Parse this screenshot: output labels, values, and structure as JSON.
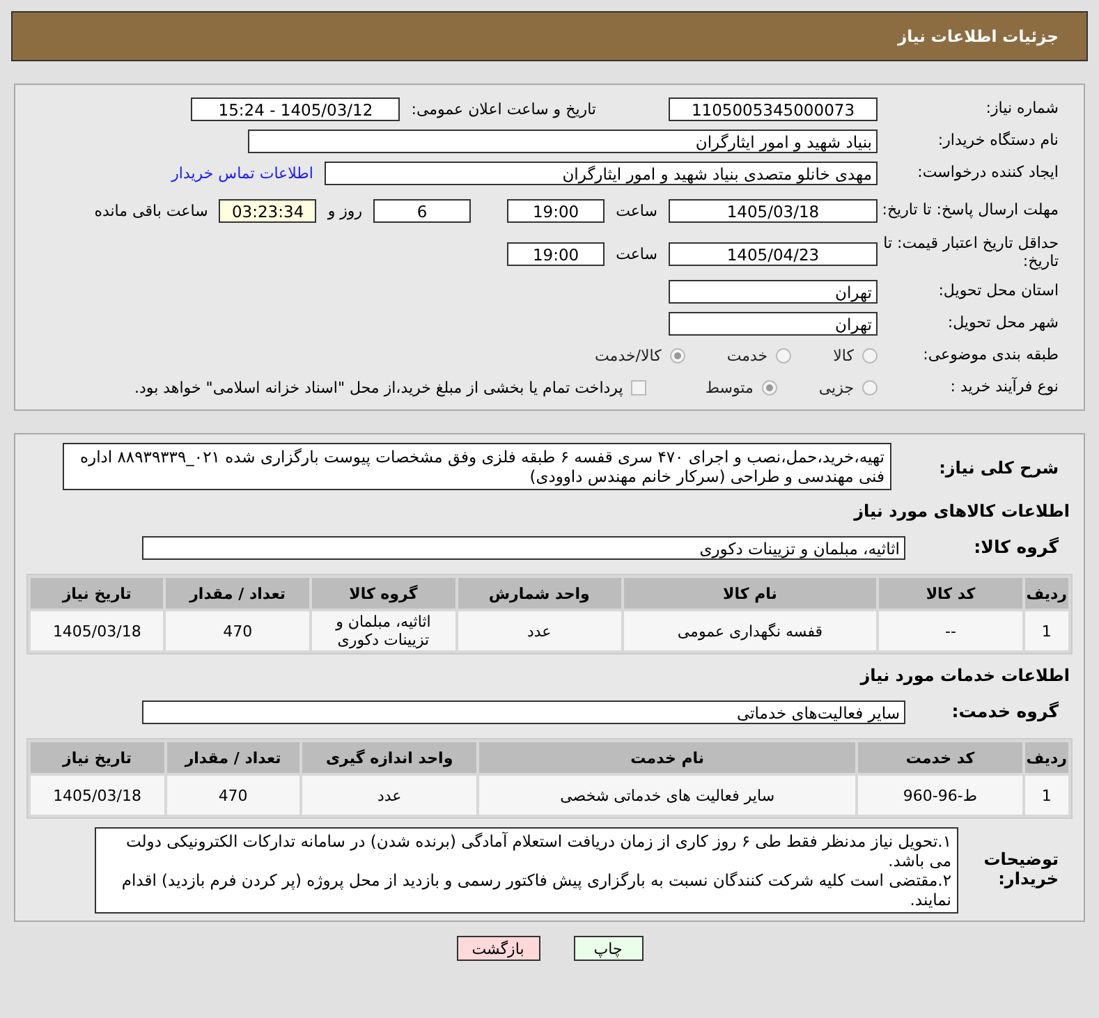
{
  "header": {
    "title": "جزئیات اطلاعات نیاز"
  },
  "need_number": {
    "label": "شماره نیاز:",
    "value": "1105005345000073"
  },
  "announce": {
    "label": "تاریخ و ساعت اعلان عمومی:",
    "value": "1405/03/12 - 15:24"
  },
  "buyer": {
    "label": "نام دستگاه خریدار:",
    "value": "بنیاد شهید و امور ایثارگران"
  },
  "creator": {
    "label": "ایجاد کننده درخواست:",
    "value": "مهدی خانلو متصدی بنیاد شهید و امور ایثارگران",
    "link": "اطلاعات تماس خریدار"
  },
  "deadline": {
    "label": "مهلت ارسال پاسخ: تا تاریخ:",
    "date": "1405/03/18",
    "time_label": "ساعت",
    "time": "19:00",
    "days": "6",
    "days_label": "روز و",
    "remaining": "03:23:34",
    "remaining_label": "ساعت باقی مانده"
  },
  "validity": {
    "label": "حداقل تاریخ اعتبار قیمت: تا تاریخ:",
    "date": "1405/04/23",
    "time_label": "ساعت",
    "time": "19:00"
  },
  "province": {
    "label": "استان محل تحویل:",
    "value": "تهران"
  },
  "city": {
    "label": "شهر محل تحویل:",
    "value": "تهران"
  },
  "category": {
    "label": "طبقه بندی موضوعی:",
    "options": [
      {
        "label": "کالا",
        "selected": false
      },
      {
        "label": "خدمت",
        "selected": false
      },
      {
        "label": "کالا/خدمت",
        "selected": true
      }
    ]
  },
  "process": {
    "label": "نوع فرآیند خرید :",
    "options": [
      {
        "label": "جزیی",
        "selected": false
      },
      {
        "label": "متوسط",
        "selected": true
      }
    ],
    "payment": {
      "label": "پرداخت تمام یا بخشی از مبلغ خرید،از محل \"اسناد خزانه اسلامی\" خواهد بود.",
      "checked": false
    }
  },
  "description": {
    "label": "شرح کلی نیاز:",
    "value": "تهیه،خرید،حمل،نصب و اجرای ۴۷۰ سری قفسه ۶ طبقه فلزی وفق مشخصات پیوست بارگزاری شده ۰۲۱_۸۸۹۳۹۳۳۹ اداره فنی مهندسی و طراحی (سرکار خانم مهندس داوودی)"
  },
  "goods": {
    "title": "اطلاعات کالاهای مورد نیاز",
    "group_label": "گروه کالا:",
    "group": "اثاثیه، مبلمان و تزیینات دکوری",
    "columns": [
      "ردیف",
      "کد کالا",
      "نام کالا",
      "واحد شمارش",
      "گروه کالا",
      "تعداد / مقدار",
      "تاریخ نیاز"
    ],
    "rows": [
      [
        "1",
        "--",
        "قفسه نگهداری عمومی",
        "عدد",
        "اثاثیه، مبلمان و تزیینات دکوری",
        "470",
        "1405/03/18"
      ]
    ]
  },
  "services": {
    "title": "اطلاعات خدمات مورد نیاز",
    "group_label": "گروه خدمت:",
    "group": "سایر فعالیت‌های خدماتی",
    "columns": [
      "ردیف",
      "کد خدمت",
      "نام خدمت",
      "واحد اندازه گیری",
      "تعداد / مقدار",
      "تاریخ نیاز"
    ],
    "rows": [
      [
        "1",
        "ط-96-960",
        "سایر فعالیت های خدماتی شخصی",
        "عدد",
        "470",
        "1405/03/18"
      ]
    ]
  },
  "notes": {
    "label": "توضیحات خریدار:",
    "value": "۱.تحویل نیاز مدنظر فقط طی ۶ روز کاری از زمان دریافت استعلام آمادگی (برنده شدن) در سامانه تدارکات الکترونیکی دولت می باشد.\n۲.مقتضی است کلیه شرکت کنندگان نسبت به بارگزاری پیش فاکتور رسمی و بازدید از محل پروژه (پر کردن فرم بازدید) اقدام نمایند."
  },
  "buttons": [
    {
      "label": "چاپ",
      "kind": "print"
    },
    {
      "label": "بازگشت",
      "kind": "back"
    }
  ]
}
